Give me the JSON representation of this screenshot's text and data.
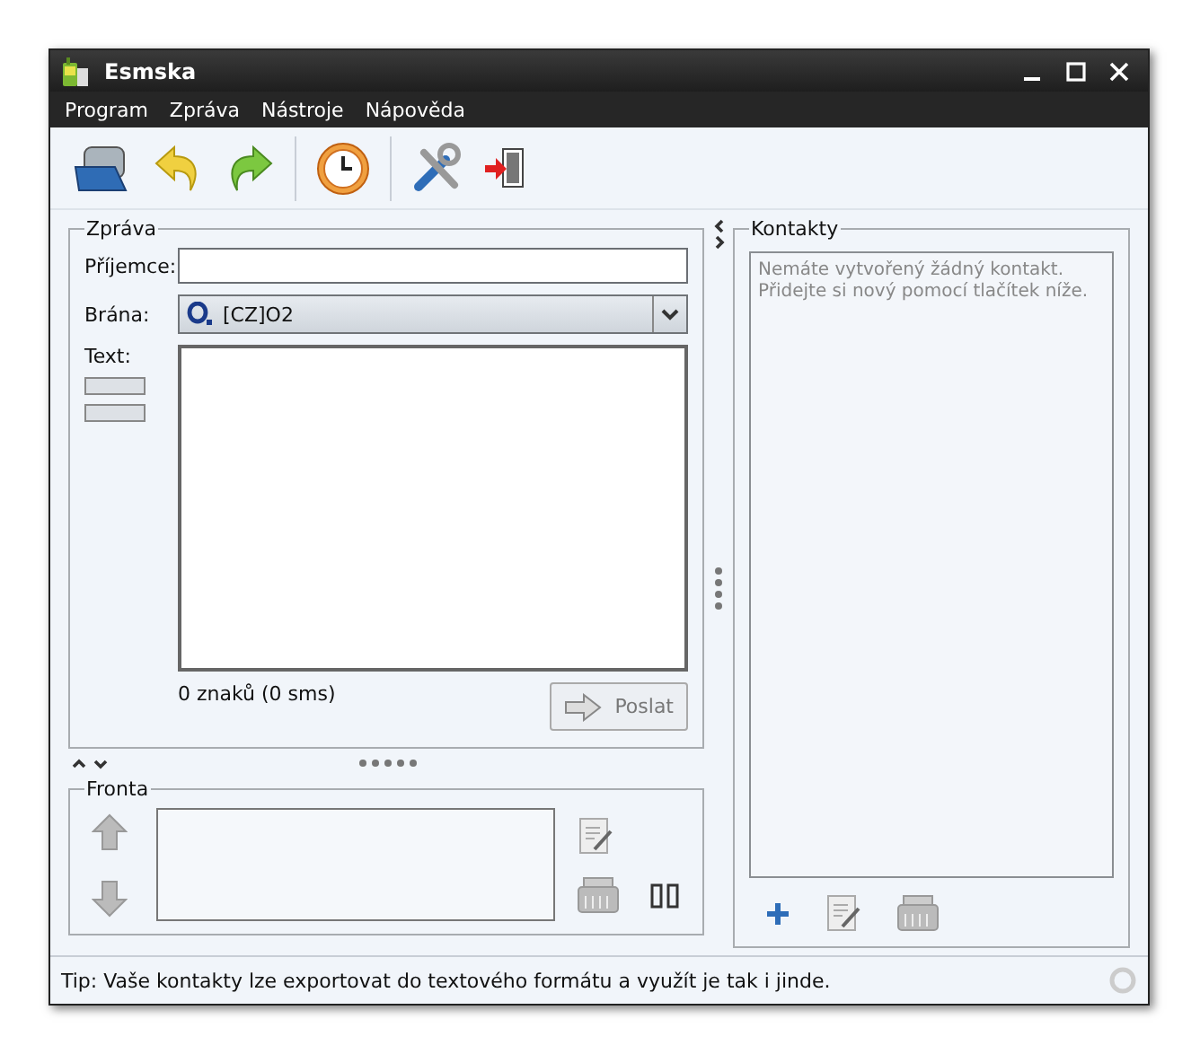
{
  "window": {
    "title": "Esmska"
  },
  "menu": [
    {
      "label": "Program"
    },
    {
      "label": "Zpráva"
    },
    {
      "label": "Nástroje"
    },
    {
      "label": "Nápověda"
    }
  ],
  "message": {
    "title": "Zpráva",
    "recipient": {
      "label": "Příjemce:"
    },
    "gateway": {
      "label": "Brána:",
      "value": "[CZ]O2"
    },
    "text": {
      "label": "Text:"
    },
    "counter": "0 znaků (0 sms)",
    "send_button": {
      "label": "Poslat",
      "disabled": true
    }
  },
  "queue": {
    "title": "Fronta"
  },
  "contacts": {
    "title": "Kontakty",
    "empty_message": [
      "Nemáte vytvořený žádný kontakt.",
      "Přidejte si nový pomocí tlačítek níže."
    ]
  },
  "status_bar": {
    "tip": "Tip: Vaše kontakty lze exportovat do textového formátu a využít je tak i jinde."
  }
}
